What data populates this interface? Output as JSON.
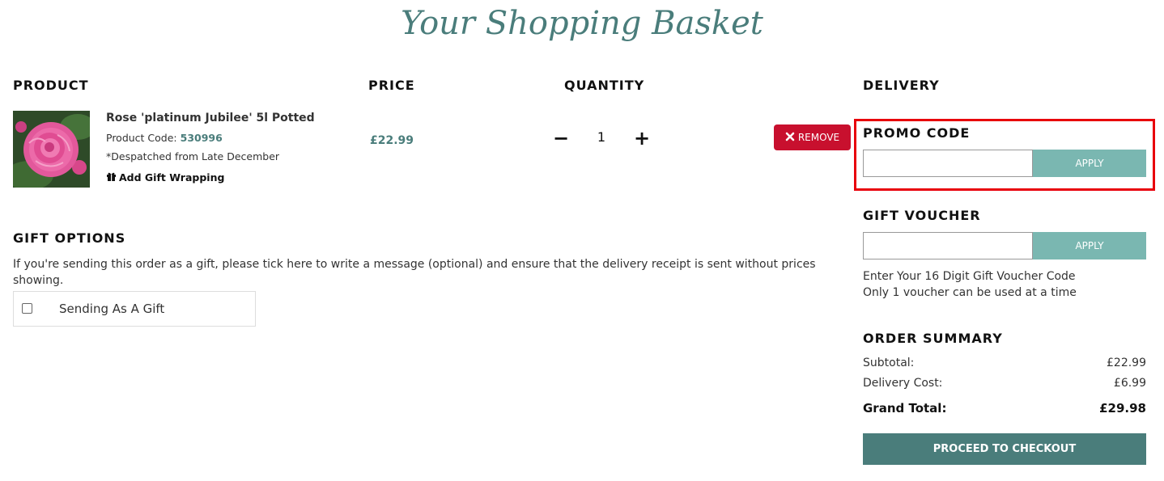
{
  "page": {
    "title": "Your Shopping Basket"
  },
  "columns": {
    "product": "PRODUCT",
    "price": "PRICE",
    "quantity": "QUANTITY",
    "delivery": "DELIVERY"
  },
  "item": {
    "name": "Rose 'platinum Jubilee' 5l Potted",
    "code_label": "Product Code:",
    "code": "530996",
    "despatch": "*Despatched from Late December",
    "gift_wrap_label": "Add Gift Wrapping",
    "price": "£22.99",
    "quantity": "1",
    "remove_label": "REMOVE"
  },
  "gift_options": {
    "title": "GIFT OPTIONS",
    "text": "If you're sending this order as a gift, please tick here to write a message (optional) and ensure that the delivery receipt is sent without prices showing.",
    "checkbox_label": "Sending As A Gift"
  },
  "promo": {
    "title": "PROMO CODE",
    "value": "",
    "apply_label": "APPLY"
  },
  "voucher": {
    "title": "GIFT VOUCHER",
    "value": "",
    "apply_label": "APPLY",
    "note_line1": "Enter Your 16 Digit Gift Voucher Code",
    "note_line2": "Only 1 voucher can be used at a time"
  },
  "summary": {
    "title": "ORDER SUMMARY",
    "subtotal_label": "Subtotal:",
    "subtotal": "£22.99",
    "delivery_label": "Delivery Cost:",
    "delivery": "£6.99",
    "total_label": "Grand Total:",
    "total": "£29.98",
    "checkout_label": "PROCEED TO CHECKOUT"
  },
  "colors": {
    "accent": "#4a7d7b",
    "apply": "#7ab7b1",
    "remove": "#c8102e",
    "highlight": "#e8000b"
  },
  "icons": {
    "gift_wrap": "gift-icon",
    "remove": "close-icon"
  }
}
